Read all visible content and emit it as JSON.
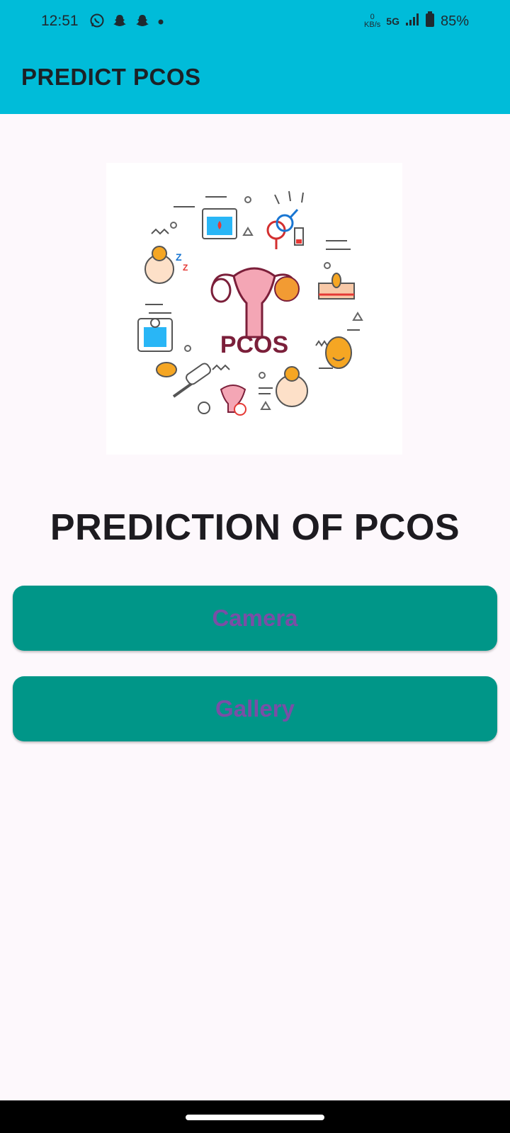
{
  "status_bar": {
    "time": "12:51",
    "net_speed_value": "0",
    "net_speed_unit": "KB/s",
    "network": "5G",
    "battery": "85%",
    "icons": [
      "whatsapp-icon",
      "snapchat-icon",
      "snapchat-icon",
      "dot-icon",
      "signal-icon",
      "battery-icon"
    ]
  },
  "app_bar": {
    "title": "PREDICT PCOS"
  },
  "illustration": {
    "label": "PCOS"
  },
  "main": {
    "heading": "PREDICTION OF PCOS",
    "camera_label": "Camera",
    "gallery_label": "Gallery"
  },
  "colors": {
    "app_bar": "#00bcd9",
    "button": "#009688",
    "button_text": "#7a4ea6",
    "background": "#fdf8fc"
  }
}
